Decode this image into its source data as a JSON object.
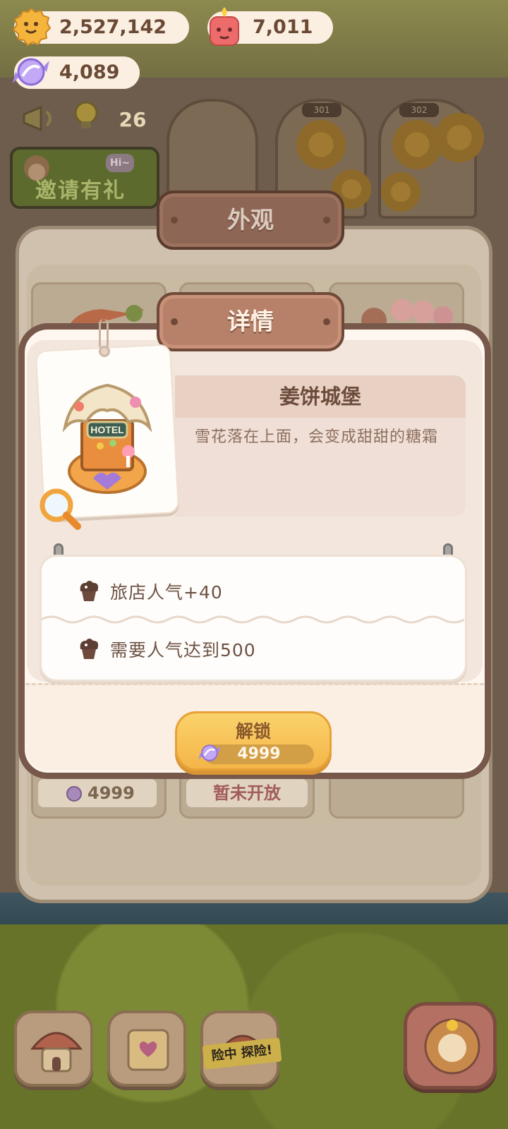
{
  "currencies": {
    "coins": "2,527,142",
    "candles": "7,011",
    "candy": "4,089"
  },
  "background": {
    "counter": "26",
    "invite_banner": "邀请有礼",
    "invite_bubble": "Hi~",
    "room_tags": [
      "301",
      "302"
    ]
  },
  "appearance_panel": {
    "title": "外观",
    "card_prices": [
      {
        "value": "4999",
        "locked": false
      },
      {
        "value": "暂未开放",
        "locked": true
      }
    ]
  },
  "detail_modal": {
    "title": "详情",
    "item_name": "姜饼城堡",
    "description": "雪花落在上面，会变成甜甜的糖霜",
    "item_sign": "HOTEL",
    "stats": [
      {
        "icon": "muffin-icon",
        "text": "旅店人气+40"
      },
      {
        "icon": "muffin-icon",
        "text": "需要人气达到500"
      }
    ],
    "unlock_button": {
      "label": "解锁",
      "price": "4999"
    }
  },
  "bottom_nav": {
    "explore_tape": "险中 探险!"
  },
  "colors": {
    "modal_border": "#77584a",
    "plaque": "#b78069",
    "button_gold": "#f4b548",
    "text_brown": "#6d4c3c"
  }
}
